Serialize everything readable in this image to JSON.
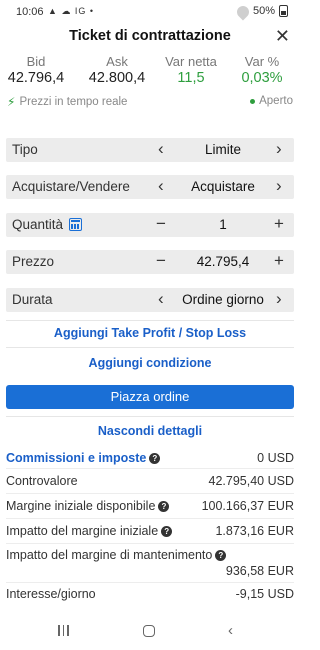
{
  "status_bar": {
    "time": "10:06",
    "icons_text": "▲ ☁ IG •",
    "battery": "50%"
  },
  "header": {
    "title": "Ticket di contrattazione",
    "close_glyph": "✕"
  },
  "quote": {
    "bid_label": "Bid",
    "bid_value": "42.796,4",
    "ask_label": "Ask",
    "ask_value": "42.800,4",
    "net_change_label": "Var netta",
    "net_change_value": "11,5",
    "pct_change_label": "Var %",
    "pct_change_value": "0,03%",
    "change_color": "#2e9e3e"
  },
  "realtime_label": "Prezzi in tempo reale",
  "market_status": "Aperto",
  "form": {
    "type_label": "Tipo",
    "type_value": "Limite",
    "side_label": "Acquistare/Vendere",
    "side_value": "Acquistare",
    "quantity_label": "Quantità",
    "quantity_value": "1",
    "price_label": "Prezzo",
    "price_value": "42.795,4",
    "duration_label": "Durata",
    "duration_value": "Ordine giorno",
    "prev_glyph": "‹",
    "next_glyph": "›",
    "minus_glyph": "−",
    "plus_glyph": "+"
  },
  "links": {
    "take_profit_stop_loss": "Aggiungi Take Profit / Stop Loss",
    "add_condition": "Aggiungi condizione",
    "hide_details": "Nascondi dettagli"
  },
  "place_order_label": "Piazza ordine",
  "accent_color": "#1a6fd6",
  "details": [
    {
      "label": "Commissioni e imposte",
      "value": "0 USD",
      "info": true,
      "emphasis": true
    },
    {
      "label": "Controvalore",
      "value": "42.795,40 USD",
      "info": false,
      "emphasis": false
    },
    {
      "label": "Margine iniziale disponibile",
      "value": "100.166,37 EUR",
      "info": true,
      "emphasis": false
    },
    {
      "label": "Impatto del margine iniziale",
      "value": "1.873,16 EUR",
      "info": true,
      "emphasis": false
    },
    {
      "label": "Impatto del margine di mantenimento",
      "value": "936,58 EUR",
      "info": true,
      "emphasis": false
    },
    {
      "label": "Interesse/giorno",
      "value": "-9,15 USD",
      "info": false,
      "emphasis": false
    }
  ]
}
